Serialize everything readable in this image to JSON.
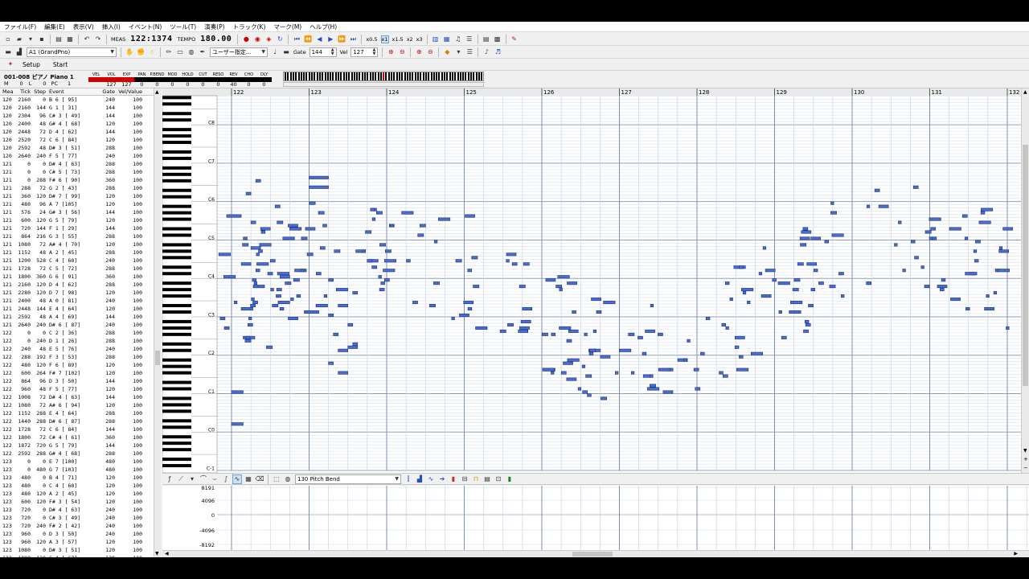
{
  "menu": [
    "ファイル(F)",
    "編集(E)",
    "表示(V)",
    "挿入(I)",
    "イベント(N)",
    "ツール(T)",
    "演奏(P)",
    "トラック(K)",
    "マーク(M)",
    "ヘルプ(H)"
  ],
  "toolbar": {
    "meas_label": "MEAS",
    "position": "122:1374",
    "tempo_label": "TEMPO",
    "tempo": "180.00",
    "speeds": [
      "x0.5",
      "x1",
      "x1.5",
      "x2",
      "x3"
    ]
  },
  "toolbar2": {
    "instrument": "A1 (GrandPno)",
    "tool_mode": "ユーザー指定…",
    "gate_label": "Gate",
    "gate_value": "144",
    "vel_label": "Vel",
    "vel_value": "127"
  },
  "tabs": [
    "Setup",
    "Start"
  ],
  "track": {
    "name": "001-008 ピアノ Piano 1",
    "sub_m": "M",
    "sub_m_val": "0",
    "sub_l": "L",
    "sub_l_val": "0",
    "sub_pc": "PC",
    "sub_pc_val": "1",
    "controls": [
      {
        "label": "VEL",
        "value": "",
        "color": "#d00000"
      },
      {
        "label": "VOL",
        "value": "127",
        "color": "#d00000"
      },
      {
        "label": "EXP",
        "value": "127",
        "color": "#d00000"
      },
      {
        "label": "PAN",
        "value": "0",
        "color": "#000000"
      },
      {
        "label": "P.BEND",
        "value": "0",
        "color": "#000000"
      },
      {
        "label": "MOD",
        "value": "0",
        "color": "#000000"
      },
      {
        "label": "HOLD",
        "value": "0",
        "color": "#000000"
      },
      {
        "label": "CUT",
        "value": "0",
        "color": "#000000"
      },
      {
        "label": "RESO",
        "value": "0",
        "color": "#000000"
      },
      {
        "label": "REV",
        "value": "40",
        "color": "#000000"
      },
      {
        "label": "CHO",
        "value": "0",
        "color": "#000000"
      },
      {
        "label": "DLY",
        "value": "0",
        "color": "#000000"
      }
    ]
  },
  "eventlist": {
    "headers": [
      "Mea",
      "Tick",
      "Step",
      "Event",
      "Gate",
      "Vel/Value"
    ],
    "rows": [
      [
        "120",
        "2160",
        "0",
        "B 6 [ 95]",
        "240",
        "100"
      ],
      [
        "120",
        "2160",
        "144",
        "G 1 [ 31]",
        "144",
        "100"
      ],
      [
        "120",
        "2304",
        "96",
        "C# 3 [ 49]",
        "144",
        "100"
      ],
      [
        "120",
        "2400",
        "48",
        "G# 4 [ 68]",
        "120",
        "100"
      ],
      [
        "120",
        "2448",
        "72",
        "D 4 [ 62]",
        "144",
        "100"
      ],
      [
        "120",
        "2520",
        "72",
        "C 6 [ 84]",
        "120",
        "100"
      ],
      [
        "120",
        "2592",
        "48",
        "D# 3 [ 51]",
        "288",
        "100"
      ],
      [
        "120",
        "2640",
        "240",
        "F 5 [ 77]",
        "240",
        "100"
      ],
      [
        "121",
        "0",
        "0",
        "D# 4 [ 63]",
        "288",
        "100"
      ],
      [
        "121",
        "0",
        "0",
        "C# 5 [ 73]",
        "288",
        "100"
      ],
      [
        "121",
        "0",
        "288",
        "F# 6 [ 90]",
        "360",
        "100"
      ],
      [
        "121",
        "288",
        "72",
        "G 2 [ 43]",
        "288",
        "100"
      ],
      [
        "121",
        "360",
        "120",
        "D# 7 [ 99]",
        "120",
        "100"
      ],
      [
        "121",
        "480",
        "96",
        "A 7 [105]",
        "120",
        "100"
      ],
      [
        "121",
        "576",
        "24",
        "G# 3 [ 56]",
        "144",
        "100"
      ],
      [
        "121",
        "600",
        "120",
        "G 5 [ 79]",
        "120",
        "100"
      ],
      [
        "121",
        "720",
        "144",
        "F 1 [ 29]",
        "144",
        "100"
      ],
      [
        "121",
        "864",
        "216",
        "G 3 [ 55]",
        "288",
        "100"
      ],
      [
        "121",
        "1080",
        "72",
        "A# 4 [ 70]",
        "120",
        "100"
      ],
      [
        "121",
        "1152",
        "48",
        "A 2 [ 45]",
        "288",
        "100"
      ],
      [
        "121",
        "1200",
        "528",
        "C 4 [ 60]",
        "240",
        "100"
      ],
      [
        "121",
        "1728",
        "72",
        "C 5 [ 72]",
        "288",
        "100"
      ],
      [
        "121",
        "1800",
        "360",
        "G 6 [ 91]",
        "360",
        "100"
      ],
      [
        "121",
        "2160",
        "120",
        "D 4 [ 62]",
        "288",
        "100"
      ],
      [
        "121",
        "2280",
        "120",
        "D 7 [ 98]",
        "120",
        "100"
      ],
      [
        "121",
        "2400",
        "48",
        "A 0 [ 81]",
        "240",
        "100"
      ],
      [
        "121",
        "2448",
        "144",
        "E 4 [ 64]",
        "120",
        "100"
      ],
      [
        "121",
        "2592",
        "48",
        "A 4 [ 69]",
        "144",
        "100"
      ],
      [
        "121",
        "2640",
        "240",
        "D# 6 [ 87]",
        "240",
        "100"
      ],
      [
        "122",
        "0",
        "0",
        "C 2 [ 36]",
        "288",
        "100"
      ],
      [
        "122",
        "0",
        "240",
        "D 1 [ 26]",
        "288",
        "100"
      ],
      [
        "122",
        "240",
        "48",
        "E 5 [ 76]",
        "240",
        "100"
      ],
      [
        "122",
        "288",
        "192",
        "F 3 [ 53]",
        "288",
        "100"
      ],
      [
        "122",
        "480",
        "120",
        "F 6 [ 89]",
        "120",
        "100"
      ],
      [
        "122",
        "600",
        "264",
        "F# 7 [102]",
        "120",
        "100"
      ],
      [
        "122",
        "864",
        "96",
        "D 3 [ 50]",
        "144",
        "100"
      ],
      [
        "122",
        "960",
        "48",
        "F 5 [ 77]",
        "120",
        "100"
      ],
      [
        "122",
        "1008",
        "72",
        "D# 4 [ 63]",
        "144",
        "100"
      ],
      [
        "122",
        "1080",
        "72",
        "A# 6 [ 94]",
        "120",
        "100"
      ],
      [
        "122",
        "1152",
        "288",
        "E 4 [ 64]",
        "288",
        "100"
      ],
      [
        "122",
        "1440",
        "288",
        "D# 6 [ 87]",
        "288",
        "100"
      ],
      [
        "122",
        "1728",
        "72",
        "C 6 [ 84]",
        "144",
        "100"
      ],
      [
        "122",
        "1800",
        "72",
        "C# 4 [ 61]",
        "360",
        "100"
      ],
      [
        "122",
        "1872",
        "720",
        "G 5 [ 79]",
        "144",
        "100"
      ],
      [
        "122",
        "2592",
        "288",
        "G# 4 [ 68]",
        "288",
        "100"
      ],
      [
        "123",
        "0",
        "0",
        "E 7 [100]",
        "480",
        "100"
      ],
      [
        "123",
        "0",
        "480",
        "G 7 [103]",
        "480",
        "100"
      ],
      [
        "123",
        "480",
        "0",
        "B 4 [ 71]",
        "120",
        "100"
      ],
      [
        "123",
        "480",
        "0",
        "C 4 [ 60]",
        "120",
        "100"
      ],
      [
        "123",
        "480",
        "120",
        "A 2 [ 45]",
        "120",
        "100"
      ],
      [
        "123",
        "600",
        "120",
        "F# 3 [ 54]",
        "120",
        "100"
      ],
      [
        "123",
        "720",
        "0",
        "D# 4 [ 63]",
        "240",
        "100"
      ],
      [
        "123",
        "720",
        "0",
        "C# 3 [ 49]",
        "240",
        "100"
      ],
      [
        "123",
        "720",
        "240",
        "F# 2 [ 42]",
        "240",
        "100"
      ],
      [
        "123",
        "960",
        "0",
        "D 3 [ 50]",
        "240",
        "100"
      ],
      [
        "123",
        "960",
        "120",
        "A 3 [ 57]",
        "120",
        "100"
      ],
      [
        "123",
        "1080",
        "0",
        "D# 3 [ 51]",
        "120",
        "100"
      ],
      [
        "123",
        "1080",
        "120",
        "G 4 [ 67]",
        "120",
        "100"
      ]
    ]
  },
  "pianoroll": {
    "measures": [
      "122",
      "123",
      "124",
      "125",
      "126",
      "127",
      "128",
      "129",
      "130",
      "131",
      "132"
    ],
    "octaves": [
      "C8",
      "C7",
      "C6",
      "C5",
      "C4",
      "C3",
      "C2",
      "C1",
      "C0",
      "C-1"
    ]
  },
  "controller": {
    "selected": "130 Pitch Bend",
    "scale": [
      "8191",
      "4096",
      "0",
      "-4096",
      "-8192"
    ]
  }
}
